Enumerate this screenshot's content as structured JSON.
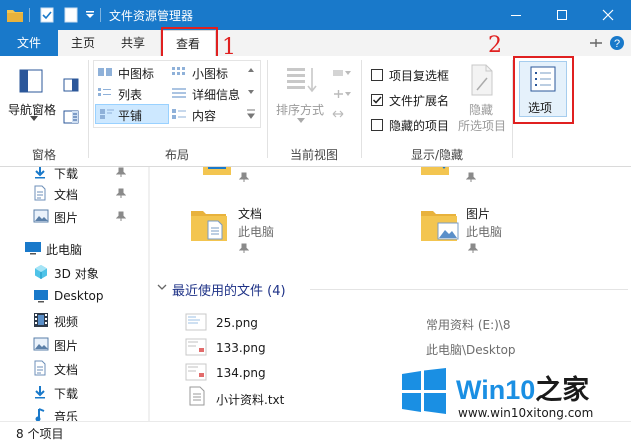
{
  "window": {
    "title": "文件资源管理器"
  },
  "tabs": {
    "file": "文件",
    "home": "主页",
    "share": "共享",
    "view": "查看"
  },
  "ribbon": {
    "pane": {
      "nav_pane": "导航窗格",
      "label": "窗格"
    },
    "layout": {
      "medium_icons": "中图标",
      "small_icons": "小图标",
      "list": "列表",
      "details": "详细信息",
      "tiles": "平铺",
      "content": "内容",
      "label": "布局"
    },
    "current_view": {
      "sort_by": "排序方式",
      "label": "当前视图"
    },
    "show_hide": {
      "item_checkboxes": "项目复选框",
      "file_extensions": "文件扩展名",
      "hidden_items": "隐藏的项目",
      "hide_selected_l1": "隐藏",
      "hide_selected_l2": "所选项目",
      "label": "显示/隐藏",
      "item_checkboxes_checked": false,
      "file_extensions_checked": true,
      "hidden_items_checked": false
    },
    "options": {
      "label": "选项"
    }
  },
  "annotations": {
    "step1": "1",
    "step2": "2"
  },
  "nav": {
    "items": [
      {
        "label": "下载"
      },
      {
        "label": "文档"
      },
      {
        "label": "图片"
      },
      {
        "label": "此电脑"
      },
      {
        "label": "3D 对象"
      },
      {
        "label": "Desktop"
      },
      {
        "label": "视频"
      },
      {
        "label": "图片"
      },
      {
        "label": "文档"
      },
      {
        "label": "下载"
      },
      {
        "label": "音乐"
      }
    ]
  },
  "content": {
    "folders": [
      {
        "name": "文档",
        "location": "此电脑"
      },
      {
        "name": "图片",
        "location": "此电脑"
      }
    ],
    "recent_header": "最近使用的文件 (4)",
    "recent_files": [
      {
        "name": "25.png",
        "path": "常用资料 (E:)\\8"
      },
      {
        "name": "133.png",
        "path": "此电脑\\Desktop"
      },
      {
        "name": "134.png",
        "path": ""
      },
      {
        "name": "小计资料.txt",
        "path": ""
      }
    ]
  },
  "status": {
    "count": "8 个项目"
  },
  "watermark": {
    "brand_a": "Win10",
    "brand_b": "之家",
    "url": "www.win10xitong.com"
  },
  "colors": {
    "title_bar": "#1979ca",
    "accent": "#1979ca",
    "annotation": "#e02020",
    "watermark": "#1a8fe3"
  }
}
